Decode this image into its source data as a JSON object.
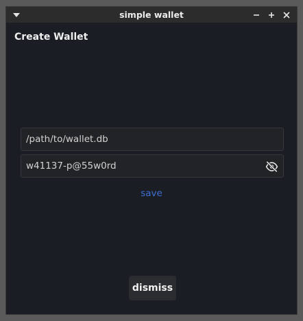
{
  "window": {
    "title": "simple wallet"
  },
  "page": {
    "heading": "Create Wallet"
  },
  "form": {
    "path_value": "/path/to/wallet.db",
    "password_value": "w41137-p@55w0rd",
    "password_toggle_icon": "eye-off-icon",
    "save_label": "save",
    "dismiss_label": "dismiss"
  },
  "colors": {
    "window_bg": "#1a1d24",
    "titlebar_bg": "#2c2c2c",
    "field_bg": "#222326",
    "link_accent": "#3e6fd1",
    "button_bg": "#2b2c30"
  }
}
